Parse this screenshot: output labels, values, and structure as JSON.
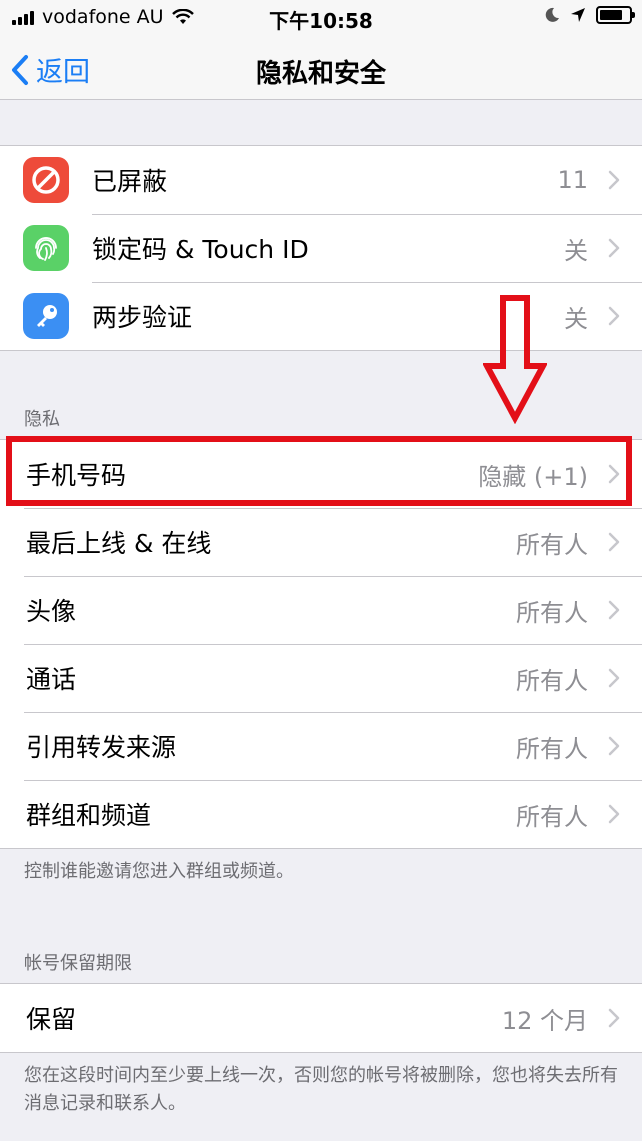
{
  "status_bar": {
    "carrier": "vodafone AU",
    "time": "下午10:58"
  },
  "nav": {
    "back_label": "返回",
    "title": "隐私和安全"
  },
  "security": [
    {
      "label": "已屏蔽",
      "value": "11",
      "icon": "blocked-icon",
      "color": "#ee4b3a"
    },
    {
      "label": "锁定码 & Touch ID",
      "value": "关",
      "icon": "fingerprint-icon",
      "color": "#5ad167"
    },
    {
      "label": "两步验证",
      "value": "关",
      "icon": "key-icon",
      "color": "#3b8ff3"
    }
  ],
  "privacy": {
    "header": "隐私",
    "items": [
      {
        "label": "手机号码",
        "value": "隐藏 (+1)"
      },
      {
        "label": "最后上线 & 在线",
        "value": "所有人"
      },
      {
        "label": "头像",
        "value": "所有人"
      },
      {
        "label": "通话",
        "value": "所有人"
      },
      {
        "label": "引用转发来源",
        "value": "所有人"
      },
      {
        "label": "群组和频道",
        "value": "所有人"
      }
    ],
    "footer": "控制谁能邀请您进入群组或频道。"
  },
  "retention": {
    "header": "帐号保留期限",
    "label": "保留",
    "value": "12 个月",
    "footer": "您在这段时间内至少要上线一次，否则您的帐号将被删除，您也将失去所有消息记录和联系人。"
  },
  "colors": {
    "accent": "#1b7ef5",
    "highlight": "#e30f18"
  }
}
